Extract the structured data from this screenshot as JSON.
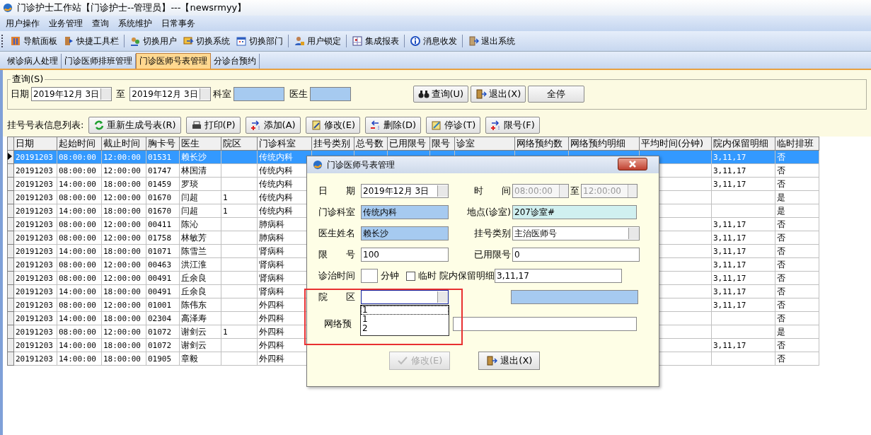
{
  "window": {
    "title": "门诊护士工作站【门诊护士--管理员】---【newsrmyy】"
  },
  "menu": [
    "用户操作",
    "业务管理",
    "查询",
    "系统维护",
    "日常事务"
  ],
  "toolbar": [
    "导航面板",
    "快捷工具栏",
    "切换用户",
    "切换系统",
    "切换部门",
    "用户锁定",
    "集成报表",
    "消息收发",
    "退出系统"
  ],
  "tabs": [
    {
      "label": "候诊病人处理",
      "selected": false
    },
    {
      "label": "门诊医师排班管理",
      "selected": false
    },
    {
      "label": "门诊医师号表管理",
      "selected": true
    },
    {
      "label": "分诊台预约",
      "selected": false
    }
  ],
  "query": {
    "legend": "查询(S)",
    "date_label": "日期",
    "date_from": "2019年12月 3日",
    "to_label": "至",
    "date_to": "2019年12月 3日",
    "dept_label": "科室",
    "doctor_label": "医生",
    "buttons": [
      "查询(U)",
      "退出(X)",
      "全停"
    ]
  },
  "list": {
    "label": "挂号号表信息列表:",
    "buttons": [
      "重新生成号表(R)",
      "打印(P)",
      "添加(A)",
      "修改(E)",
      "删除(D)",
      "停诊(T)",
      "限号(F)"
    ]
  },
  "table": {
    "columns": [
      "日期",
      "起始时间",
      "截止时间",
      "胸卡号",
      "医生",
      "院区",
      "门诊科室",
      "挂号类别",
      "总号数",
      "已用限号",
      "限号",
      "诊室",
      "网络预约数",
      "网络预约明细",
      "平均时间(分钟)",
      "院内保留明细",
      "临时排班"
    ],
    "rows": [
      {
        "selected": true,
        "date": "20191203",
        "start": "08:00:00",
        "end": "12:00:00",
        "card": "01531",
        "doctor": "赖长沙",
        "dept": "传统内科",
        "reserve": "3,11,17",
        "temp": "否"
      },
      {
        "selected": false,
        "date": "20191203",
        "start": "08:00:00",
        "end": "12:00:00",
        "card": "01747",
        "doctor": "林国清",
        "dept": "传统内科",
        "reserve": "3,11,17",
        "temp": "否"
      },
      {
        "selected": false,
        "date": "20191203",
        "start": "14:00:00",
        "end": "18:00:00",
        "card": "01459",
        "doctor": "罗琰",
        "dept": "传统内科",
        "reserve": "3,11,17",
        "temp": "否"
      },
      {
        "selected": false,
        "date": "20191203",
        "start": "08:00:00",
        "end": "12:00:00",
        "card": "01670",
        "doctor": "闫超",
        "area": "1",
        "dept": "传统内科",
        "temp": "是"
      },
      {
        "selected": false,
        "date": "20191203",
        "start": "14:00:00",
        "end": "18:00:00",
        "card": "01670",
        "doctor": "闫超",
        "area": "1",
        "dept": "传统内科",
        "temp": "是"
      },
      {
        "selected": false,
        "date": "20191203",
        "start": "08:00:00",
        "end": "12:00:00",
        "card": "00411",
        "doctor": "陈沁",
        "dept": "肺病科",
        "reserve": "3,11,17",
        "temp": "否"
      },
      {
        "selected": false,
        "date": "20191203",
        "start": "08:00:00",
        "end": "12:00:00",
        "card": "01758",
        "doctor": "林敏芳",
        "dept": "肺病科",
        "reserve": "3,11,17",
        "temp": "否"
      },
      {
        "selected": false,
        "date": "20191203",
        "start": "14:00:00",
        "end": "18:00:00",
        "card": "01071",
        "doctor": "陈雪兰",
        "dept": "肾病科",
        "reserve": "3,11,17",
        "temp": "否"
      },
      {
        "selected": false,
        "date": "20191203",
        "start": "08:00:00",
        "end": "12:00:00",
        "card": "00463",
        "doctor": "洪江淮",
        "dept": "肾病科",
        "reserve": "3,11,17",
        "temp": "否"
      },
      {
        "selected": false,
        "date": "20191203",
        "start": "08:00:00",
        "end": "12:00:00",
        "card": "00491",
        "doctor": "丘余良",
        "dept": "肾病科",
        "reserve": "3,11,17",
        "temp": "否"
      },
      {
        "selected": false,
        "date": "20191203",
        "start": "14:00:00",
        "end": "18:00:00",
        "card": "00491",
        "doctor": "丘余良",
        "dept": "肾病科",
        "reserve": "3,11,17",
        "temp": "否"
      },
      {
        "selected": false,
        "date": "20191203",
        "start": "08:00:00",
        "end": "12:00:00",
        "card": "01001",
        "doctor": "陈伟东",
        "dept": "外四科",
        "reserve": "3,11,17",
        "temp": "否"
      },
      {
        "selected": false,
        "date": "20191203",
        "start": "14:00:00",
        "end": "18:00:00",
        "card": "02304",
        "doctor": "高泽寿",
        "dept": "外四科",
        "temp": "否"
      },
      {
        "selected": false,
        "date": "20191203",
        "start": "08:00:00",
        "end": "12:00:00",
        "card": "01072",
        "doctor": "谢剑云",
        "area": "1",
        "dept": "外四科",
        "temp": "是"
      },
      {
        "selected": false,
        "date": "20191203",
        "start": "14:00:00",
        "end": "18:00:00",
        "card": "01072",
        "doctor": "谢剑云",
        "dept": "外四科",
        "reserve": "3,11,17",
        "temp": "否"
      },
      {
        "selected": false,
        "date": "20191203",
        "start": "14:00:00",
        "end": "18:00:00",
        "card": "01905",
        "doctor": "章毅",
        "dept": "外四科",
        "temp": "否"
      }
    ]
  },
  "dialog": {
    "title": "门诊医师号表管理",
    "date_label": "日　　期",
    "date": "2019年12月 3日",
    "time_label": "时　　间",
    "time_from": "08:00:00",
    "to_label": "至",
    "time_to": "12:00:00",
    "dept_label": "门诊科室",
    "dept": "传统内科",
    "place_label": "地点(诊室)",
    "place": "207诊室#",
    "doctor_label": "医生姓名",
    "doctor": "赖长沙",
    "type_label": "挂号类别",
    "type": "主治医师号",
    "limit_label": "限　　号",
    "limit": "100",
    "used_label": "已用限号",
    "used": "0",
    "duration_label": "诊治时间",
    "minutes_label": "分钟",
    "temp_label": "临时",
    "temp_checked": false,
    "reserve_label": "院内保留明细",
    "reserve": "3,11,17",
    "area_label": "院　　区",
    "area_options": [
      {
        "label": "1",
        "selected": true
      },
      {
        "label": "1",
        "selected": false
      },
      {
        "label": "2",
        "selected": false
      }
    ],
    "net_label": "网络预",
    "buttons": [
      {
        "label": "修改(E)",
        "disabled": true
      },
      {
        "label": "退出(X)",
        "disabled": false
      }
    ]
  }
}
